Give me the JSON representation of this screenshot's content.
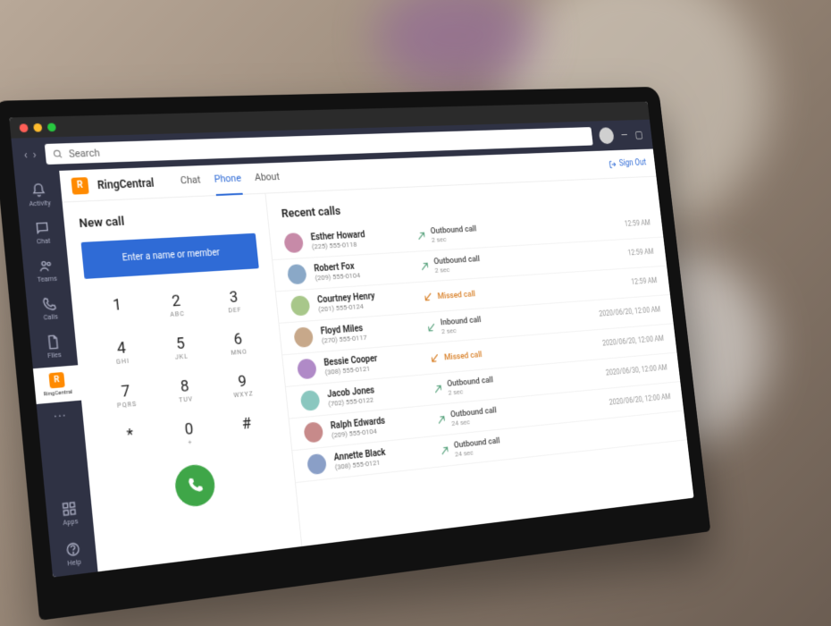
{
  "window": {
    "mac_dots": [
      "#ff5f57",
      "#febc2e",
      "#28c840"
    ]
  },
  "topbar": {
    "search_placeholder": "Search",
    "signout_label": "Sign Out"
  },
  "rail": {
    "items": [
      {
        "id": "activity",
        "label": "Activity"
      },
      {
        "id": "chat",
        "label": "Chat"
      },
      {
        "id": "teams",
        "label": "Teams"
      },
      {
        "id": "calls",
        "label": "Calls"
      },
      {
        "id": "files",
        "label": "Files"
      },
      {
        "id": "ringcentral",
        "label": "RingCentral"
      },
      {
        "id": "more",
        "label": ""
      }
    ],
    "bottom": [
      {
        "id": "apps",
        "label": "Apps"
      },
      {
        "id": "help",
        "label": "Help"
      }
    ]
  },
  "app": {
    "brand_initial": "R",
    "title": "RingCentral",
    "tabs": [
      {
        "id": "chat",
        "label": "Chat"
      },
      {
        "id": "phone",
        "label": "Phone"
      },
      {
        "id": "about",
        "label": "About"
      }
    ],
    "active_tab": "phone"
  },
  "dialer": {
    "title": "New call",
    "placeholder": "Enter a name or member",
    "keys": [
      {
        "d": "1",
        "l": ""
      },
      {
        "d": "2",
        "l": "ABC"
      },
      {
        "d": "3",
        "l": "DEF"
      },
      {
        "d": "4",
        "l": "GHI"
      },
      {
        "d": "5",
        "l": "JKL"
      },
      {
        "d": "6",
        "l": "MNO"
      },
      {
        "d": "7",
        "l": "PQRS"
      },
      {
        "d": "8",
        "l": "TUV"
      },
      {
        "d": "9",
        "l": "WXYZ"
      },
      {
        "d": "*",
        "l": ""
      },
      {
        "d": "0",
        "l": "+"
      },
      {
        "d": "#",
        "l": ""
      }
    ]
  },
  "recent": {
    "title": "Recent calls",
    "calls": [
      {
        "name": "Esther Howard",
        "phone": "(225) 555-0118",
        "type": "Outbound call",
        "type_kind": "out",
        "duration": "2 sec",
        "time": "12:59 AM"
      },
      {
        "name": "Robert Fox",
        "phone": "(209) 555-0104",
        "type": "Outbound call",
        "type_kind": "out",
        "duration": "2 sec",
        "time": "12:59 AM"
      },
      {
        "name": "Courtney Henry",
        "phone": "(201) 555-0124",
        "type": "Missed call",
        "type_kind": "missed",
        "duration": "",
        "time": "12:59 AM"
      },
      {
        "name": "Floyd Miles",
        "phone": "(270) 555-0117",
        "type": "Inbound call",
        "type_kind": "in",
        "duration": "2 sec",
        "time": "2020/06/20, 12:00 AM"
      },
      {
        "name": "Bessie Cooper",
        "phone": "(308) 555-0121",
        "type": "Missed call",
        "type_kind": "missed",
        "duration": "",
        "time": "2020/06/20, 12:00 AM"
      },
      {
        "name": "Jacob Jones",
        "phone": "(702) 555-0122",
        "type": "Outbound call",
        "type_kind": "out",
        "duration": "2 sec",
        "time": "2020/06/30, 12:00 AM"
      },
      {
        "name": "Ralph Edwards",
        "phone": "(209) 555-0104",
        "type": "Outbound call",
        "type_kind": "out",
        "duration": "24 sec",
        "time": "2020/06/20, 12:00 AM"
      },
      {
        "name": "Annette Black",
        "phone": "(308) 555-0121",
        "type": "Outbound call",
        "type_kind": "out",
        "duration": "24 sec",
        "time": ""
      }
    ]
  }
}
